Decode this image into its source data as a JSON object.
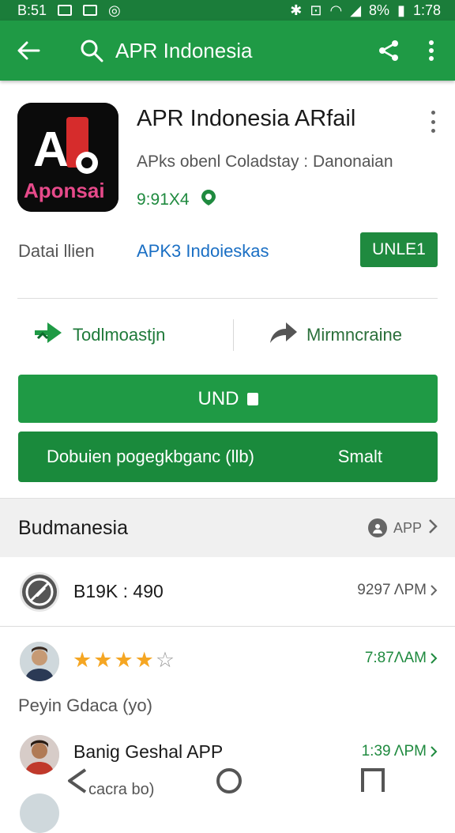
{
  "status_bar": {
    "time_left": "B:51",
    "time_right": "1:78",
    "battery": "8%"
  },
  "toolbar": {
    "title": "APR Indonesia"
  },
  "app": {
    "name": "APR Indonesia ARfail",
    "developer": "APks obenl Coladstay : Danonaian",
    "size": "9:91X4",
    "icon_text": "Aponsai",
    "icon_letters": "A"
  },
  "details": {
    "label": "Datai llien",
    "link": "APK3 Indoieskas",
    "button": "UNLE1"
  },
  "actions": {
    "left": "Todlmoastjn",
    "right": "Mirmncraine"
  },
  "buttons": {
    "primary": "UND",
    "secondary_left": "Dobuien pogegkbganc (llb)",
    "secondary_right": "Smalt"
  },
  "section": {
    "title": "Budmanesia",
    "right_label": "APP"
  },
  "rows": [
    {
      "text": "B19K : 490",
      "time": "9297 ΛPM"
    },
    {
      "rating": 4,
      "time": "7:87ΛAM",
      "caption": "Peyin Gdaca (yo)"
    },
    {
      "text": "Banig Geshal APP",
      "time": "1:39 ΛPM",
      "caption": "cacra bo)"
    }
  ],
  "colors": {
    "accent": "#1f9a45",
    "status_bar": "#1b7d3a",
    "link": "#1a6fc4",
    "star": "#f5a623"
  }
}
